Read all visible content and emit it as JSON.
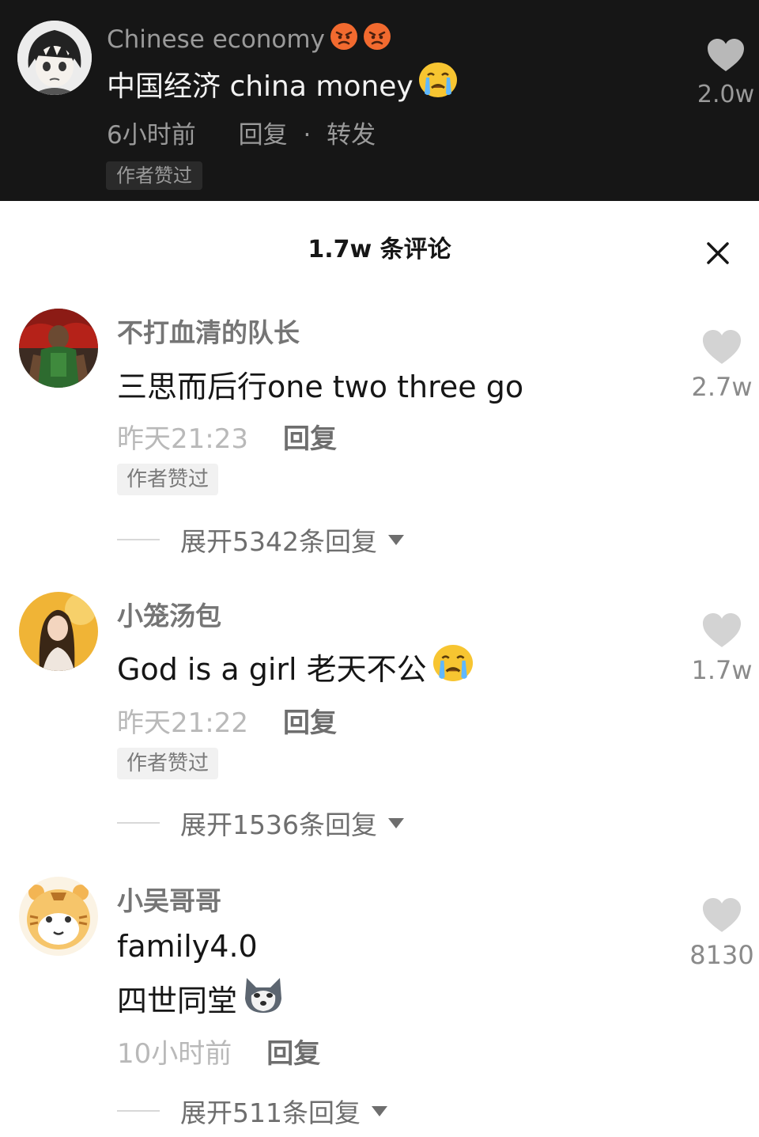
{
  "top_comment": {
    "avatar_icon": "anime-avatar-icon",
    "username": "Chinese economy",
    "username_emojis": [
      "angry-face-emoji",
      "angry-face-emoji"
    ],
    "content": "中国经济 china money",
    "content_emoji": "crying-face-emoji",
    "time": "6小时前",
    "reply_label": "回复",
    "separator": "·",
    "forward_label": "转发",
    "author_liked_tag": "作者赞过",
    "like_count": "2.0w"
  },
  "panel": {
    "title": "1.7w 条评论",
    "close_icon": "close-icon"
  },
  "comments": [
    {
      "username": "不打血清的队长",
      "content": "三思而后行one two three go",
      "time": "昨天21:23",
      "reply_label": "回复",
      "author_liked_tag": "作者赞过",
      "expand_label": "展开5342条回复",
      "like_count": "2.7w"
    },
    {
      "username": "小笼汤包",
      "content": "God is a girl 老天不公",
      "content_emoji": "crying-face-emoji",
      "time": "昨天21:22",
      "reply_label": "回复",
      "author_liked_tag": "作者赞过",
      "expand_label": "展开1536条回复",
      "like_count": "1.7w"
    },
    {
      "username": "小吴哥哥",
      "content_line1": "family4.0",
      "content_line2": "四世同堂",
      "content_emoji": "husky-dog-emoji",
      "time": "10小时前",
      "reply_label": "回复",
      "expand_label": "展开511条回复",
      "like_count": "8130"
    }
  ],
  "colors": {
    "dark_bg": "#161616",
    "light_bg": "#ffffff",
    "muted_text": "#9a9a9a",
    "like_icon_dark": "#b8b8b8",
    "like_icon_light": "#d3d3d3"
  }
}
